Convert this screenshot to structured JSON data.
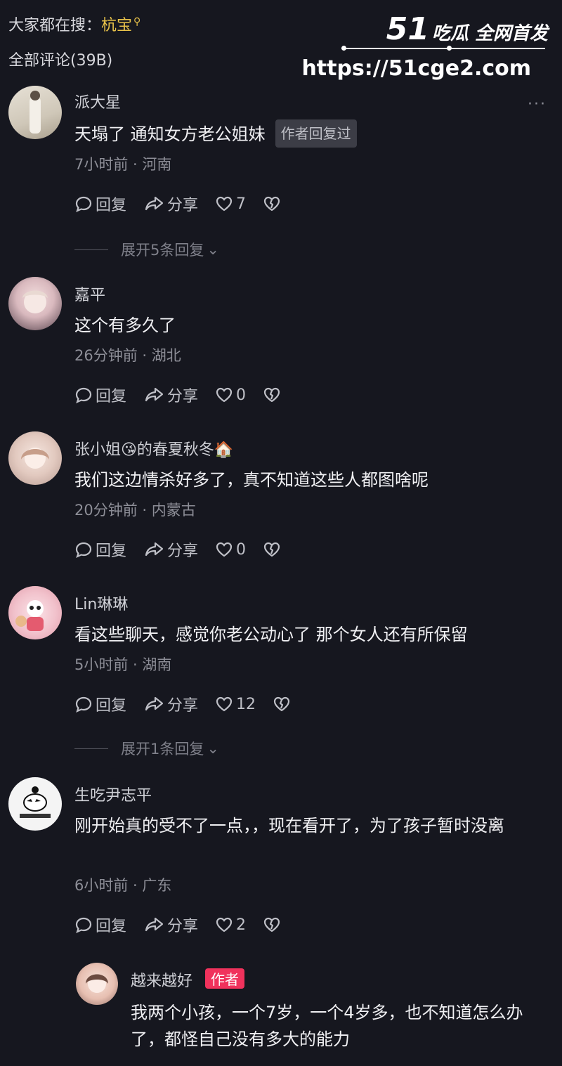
{
  "header": {
    "search_prefix": "大家都在搜：",
    "search_keyword": "杭宝",
    "total_comments": "全部评论(39B)"
  },
  "watermark": {
    "logo_number": "51",
    "logo_text": "吃瓜 全网首发",
    "url": "https://51cge2.com"
  },
  "more_label": "···",
  "actions": {
    "reply": "回复",
    "share": "分享"
  },
  "comments": [
    {
      "username": "派大星",
      "text": "天塌了 通知女方老公姐妹",
      "badge": "作者回复过",
      "meta": "7小时前 · 河南",
      "likes": "7",
      "expand": "展开5条回复"
    },
    {
      "username": "嘉平",
      "text": "这个有多久了",
      "meta": "26分钟前 · 湖北",
      "likes": "0"
    },
    {
      "username": "张小姐😘的春夏秋冬🏠",
      "text": "我们这边情杀好多了，真不知道这些人都图啥呢",
      "meta": "20分钟前 · 内蒙古",
      "likes": "0"
    },
    {
      "username": "Lin琳琳",
      "text": "看这些聊天，感觉你老公动心了 那个女人还有所保留",
      "meta": "5小时前 · 湖南",
      "likes": "12",
      "expand": "展开1条回复"
    },
    {
      "username": "生吃尹志平",
      "text": "刚开始真的受不了一点，，现在看开了，为了孩子暂时没离",
      "meta": "6小时前 · 广东",
      "likes": "2"
    }
  ],
  "reply": {
    "username": "越来越好",
    "badge": "作者",
    "text": "我两个小孩，一个7岁，一个4岁多，也不知道怎么办了，都怪自己没有多大的能力"
  },
  "colors": {
    "background": "#16171f",
    "keyword": "#e8c24a",
    "author_badge": "#f0325c"
  }
}
